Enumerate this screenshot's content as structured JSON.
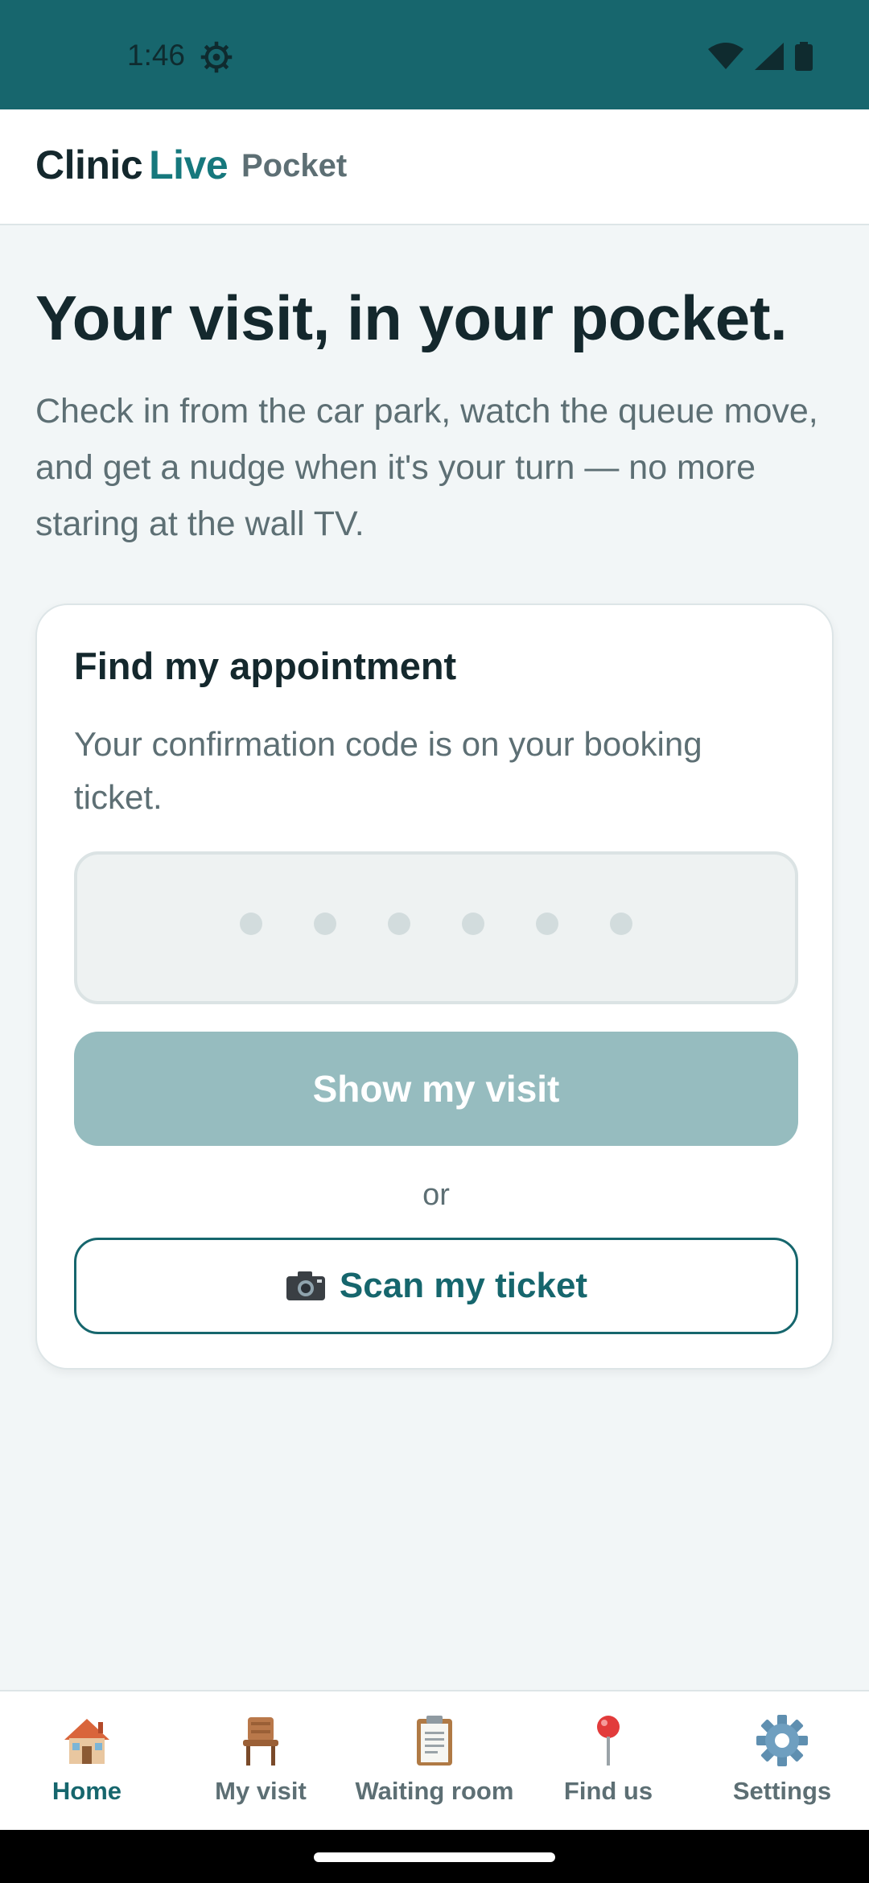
{
  "status_bar": {
    "time": "1:46"
  },
  "header": {
    "brand_first": "Clinic",
    "brand_second": "Live",
    "brand_sub": "Pocket"
  },
  "hero": {
    "title": "Your visit, in your pocket.",
    "description": "Check in from the car park, watch the queue move, and get a nudge when it's your turn — no more staring at the wall TV."
  },
  "card": {
    "title": "Find my appointment",
    "hint": "Your confirmation code is on your booking ticket.",
    "code_length": 6,
    "primary_button": "Show my visit",
    "or_text": "or",
    "scan_button": "Scan my ticket"
  },
  "nav": {
    "items": [
      {
        "label": "Home",
        "icon": "house-icon",
        "active": true
      },
      {
        "label": "My visit",
        "icon": "chair-icon",
        "active": false
      },
      {
        "label": "Waiting room",
        "icon": "clipboard-icon",
        "active": false
      },
      {
        "label": "Find us",
        "icon": "map-pin-icon",
        "active": false
      },
      {
        "label": "Settings",
        "icon": "gear-icon",
        "active": false
      }
    ]
  },
  "colors": {
    "accent": "#16666d",
    "status_bar": "#17666d",
    "primary_disabled": "#96bcbf",
    "background": "#f2f6f7"
  }
}
